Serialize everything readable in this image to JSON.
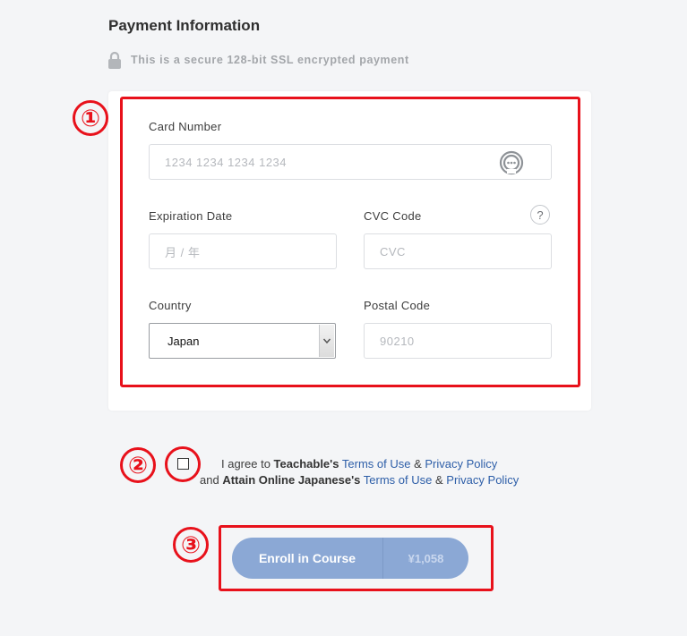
{
  "header": {
    "title": "Payment Information",
    "secure_text": "This is a secure 128-bit SSL encrypted payment"
  },
  "annotations": [
    "①",
    "②",
    "③"
  ],
  "form": {
    "card_number": {
      "label": "Card Number",
      "placeholder": "1234  1234  1234  1234"
    },
    "expiration": {
      "label": "Expiration Date",
      "placeholder": "月 / 年"
    },
    "cvc": {
      "label": "CVC Code",
      "placeholder": "CVC",
      "help": "?"
    },
    "country": {
      "label": "Country",
      "value": "Japan"
    },
    "postal": {
      "label": "Postal Code",
      "placeholder": "90210"
    }
  },
  "agreement": {
    "line1_prefix": "I agree to ",
    "line1_org": "Teachable's",
    "line2_prefix": "and ",
    "line2_org": "Attain Online Japanese's",
    "terms": "Terms of Use",
    "amp": "&",
    "privacy": "Privacy Policy"
  },
  "enroll": {
    "label": "Enroll in Course",
    "price": "¥1,058"
  },
  "colors": {
    "annotation_red": "#e8111b",
    "button": "#8ba8d5",
    "link": "#2d5ea8"
  },
  "icons": [
    "lock-icon",
    "card-brand-icon",
    "help-icon",
    "chevron-down-icon"
  ]
}
